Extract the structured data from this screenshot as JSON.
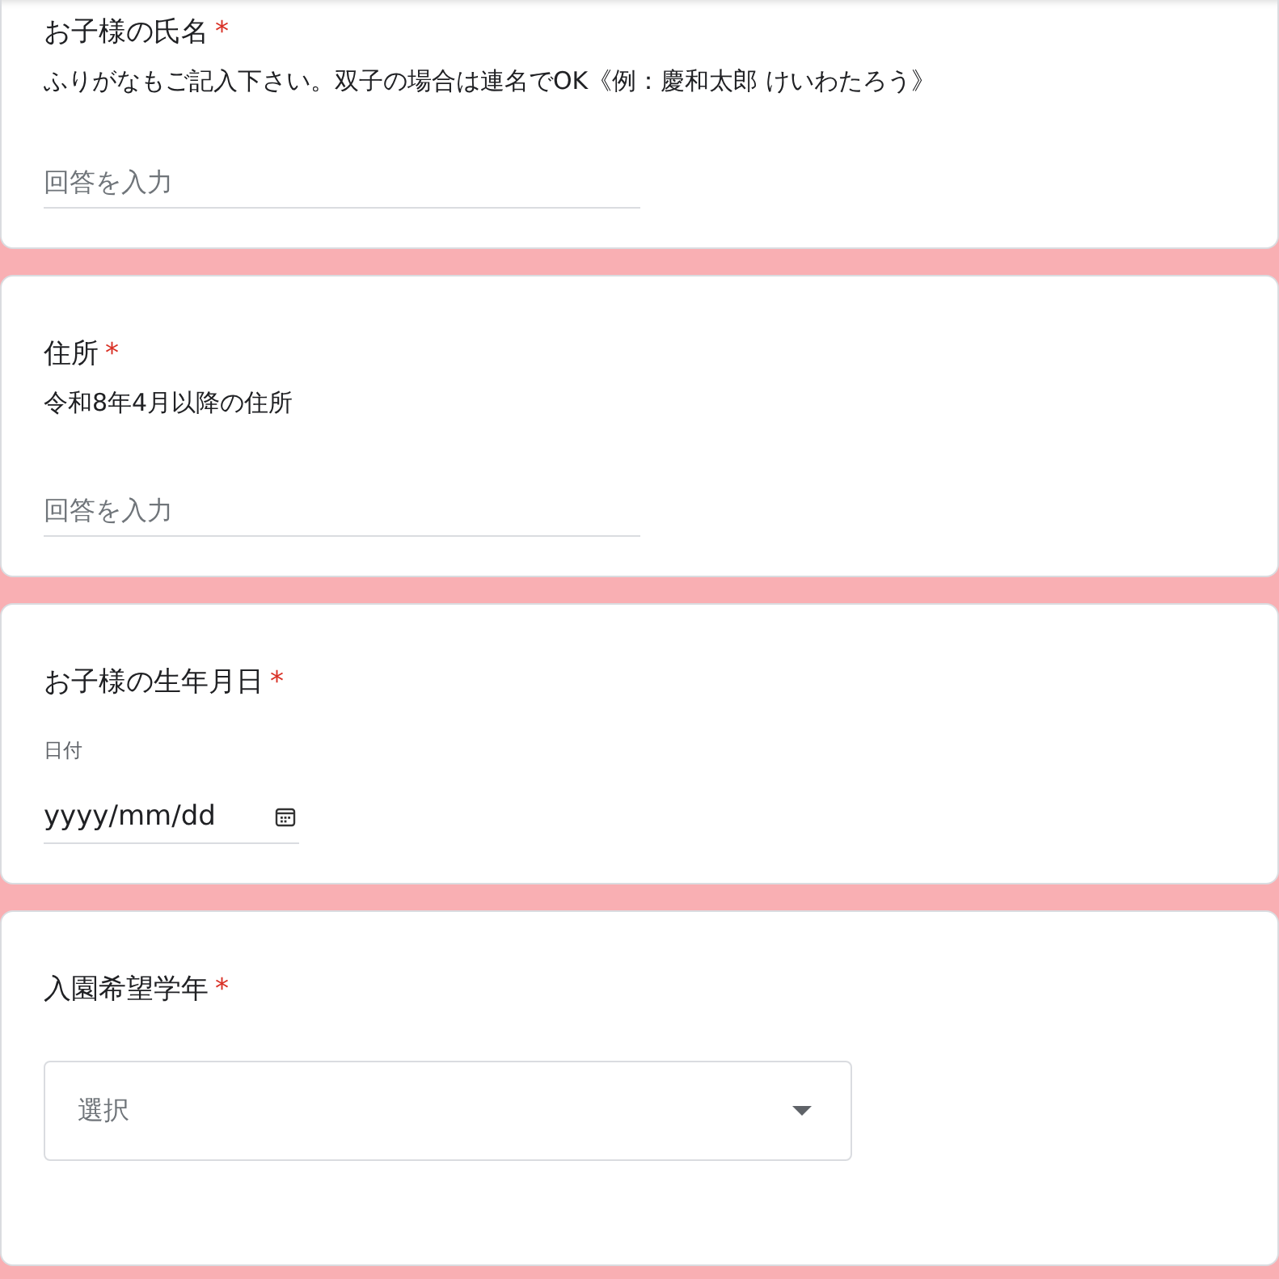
{
  "questions": [
    {
      "kind": "text",
      "title": "お子様の氏名",
      "required_mark": "*",
      "description": "ふりがなもご記入下さい。双子の場合は連名でOK《例：慶和太郎 けいわたろう》",
      "placeholder": "回答を入力"
    },
    {
      "kind": "text",
      "title": "住所",
      "required_mark": "*",
      "description": "令和8年4月以降の住所",
      "placeholder": "回答を入力"
    },
    {
      "kind": "date",
      "title": "お子様の生年月日",
      "required_mark": "*",
      "label": "日付",
      "value": "yyyy/mm/dd"
    },
    {
      "kind": "select",
      "title": "入園希望学年",
      "required_mark": "*",
      "placeholder": "選択"
    }
  ]
}
